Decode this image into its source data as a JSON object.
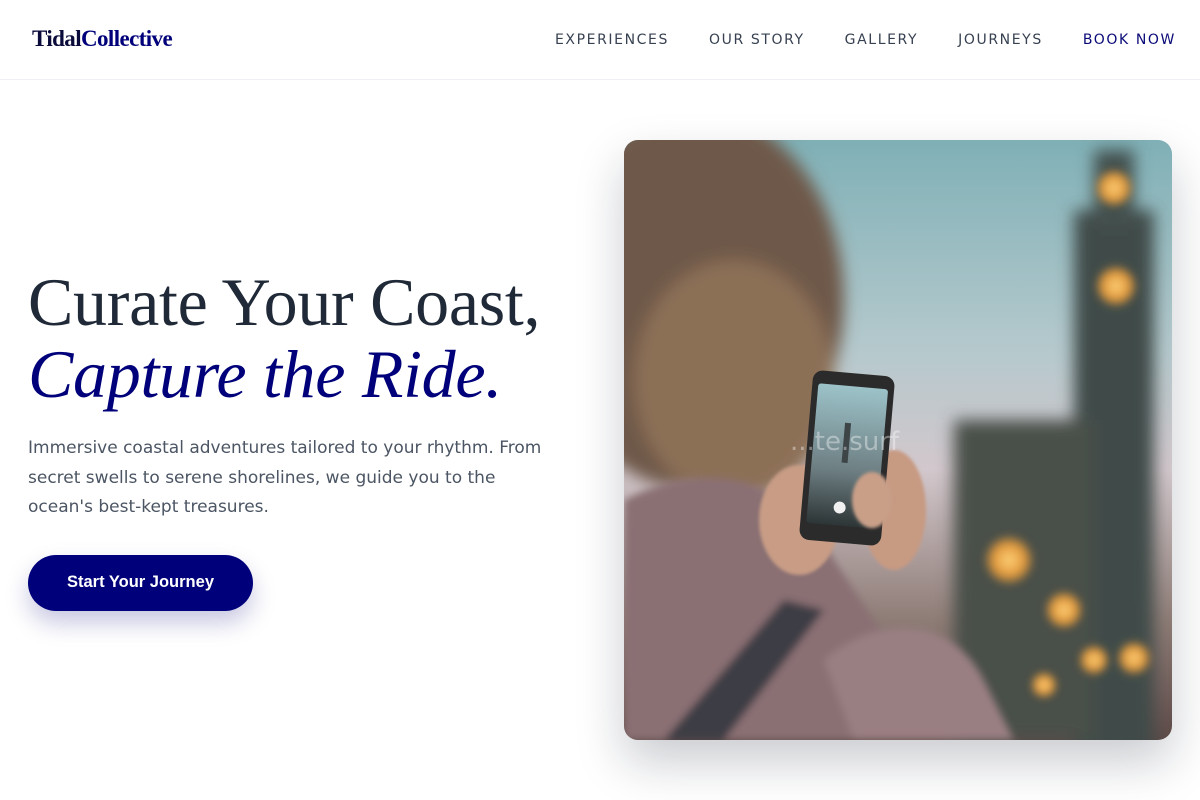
{
  "brand": {
    "part1": "Tidal",
    "part2": "Collective"
  },
  "nav": {
    "items": [
      {
        "label": "EXPERIENCES"
      },
      {
        "label": "OUR STORY"
      },
      {
        "label": "GALLERY"
      },
      {
        "label": "JOURNEYS"
      }
    ],
    "cta": "BOOK NOW"
  },
  "hero": {
    "headline_line1": "Curate Your Coast,",
    "headline_line2": "Capture the Ride.",
    "description": "Immersive coastal adventures tailored to your rhythm. From secret swells to serene shorelines, we guide you to the ocean's best-kept treasures.",
    "button": "Start Your Journey",
    "image_watermark": "...te.surf"
  },
  "colors": {
    "accent": "#00007a",
    "text": "#1f2937",
    "muted": "#4b5563"
  }
}
